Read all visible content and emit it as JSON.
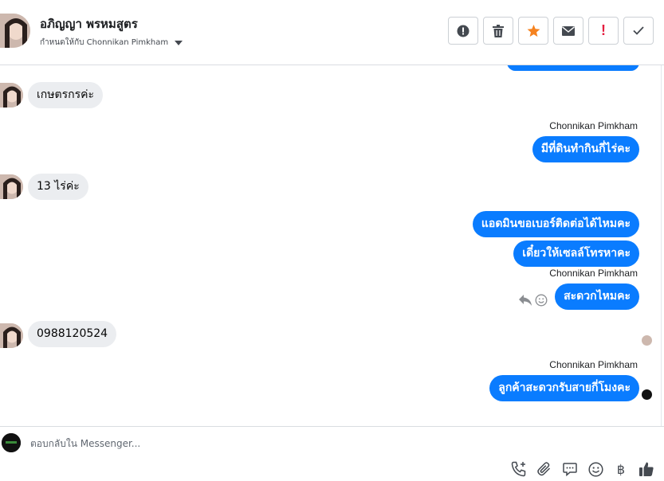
{
  "header": {
    "contact_name": "อภิญญา พรหมสูตร",
    "assigned_to": "กำหนดให้กับ Chonnikan Pimkham",
    "colors": {
      "star": "#f5821f",
      "spam": "#e41e3f"
    },
    "toolbar": [
      {
        "name": "info-icon"
      },
      {
        "name": "trash-icon"
      },
      {
        "name": "star-icon"
      },
      {
        "name": "envelope-icon"
      },
      {
        "name": "spam-icon",
        "glyph": "!"
      },
      {
        "name": "check-icon"
      }
    ]
  },
  "thread": {
    "bubble_color": "#0a7cff",
    "messages": [
      {
        "from": "customer",
        "text": "เกษตรกรค่ะ"
      },
      {
        "from": "page",
        "sender": "Chonnikan Pimkham",
        "text": "มีที่ดินทำกินกี่ไร่คะ"
      },
      {
        "from": "customer",
        "text": "13 ไร่ค่ะ"
      },
      {
        "from": "page",
        "text": "แอดมินขอเบอร์ติดต่อได้ไหมคะ"
      },
      {
        "from": "page",
        "text": "เดี๋ยวให้เซลล์โทรหาคะ"
      },
      {
        "from": "page",
        "sender": "Chonnikan Pimkham",
        "text": "สะดวกไหมคะ"
      },
      {
        "from": "customer",
        "text": "0988120524"
      },
      {
        "from": "page",
        "sender": "Chonnikan Pimkham",
        "text": "ลูกค้าสะดวกรับสายกี่โมงคะ"
      }
    ]
  },
  "composer": {
    "placeholder": "ตอบกลับใน Messenger...",
    "icons": [
      "phone-add-icon",
      "paperclip-icon",
      "message-icon",
      "emoji-icon",
      "baht-icon",
      "thumbs-up-icon"
    ],
    "baht": "฿"
  }
}
